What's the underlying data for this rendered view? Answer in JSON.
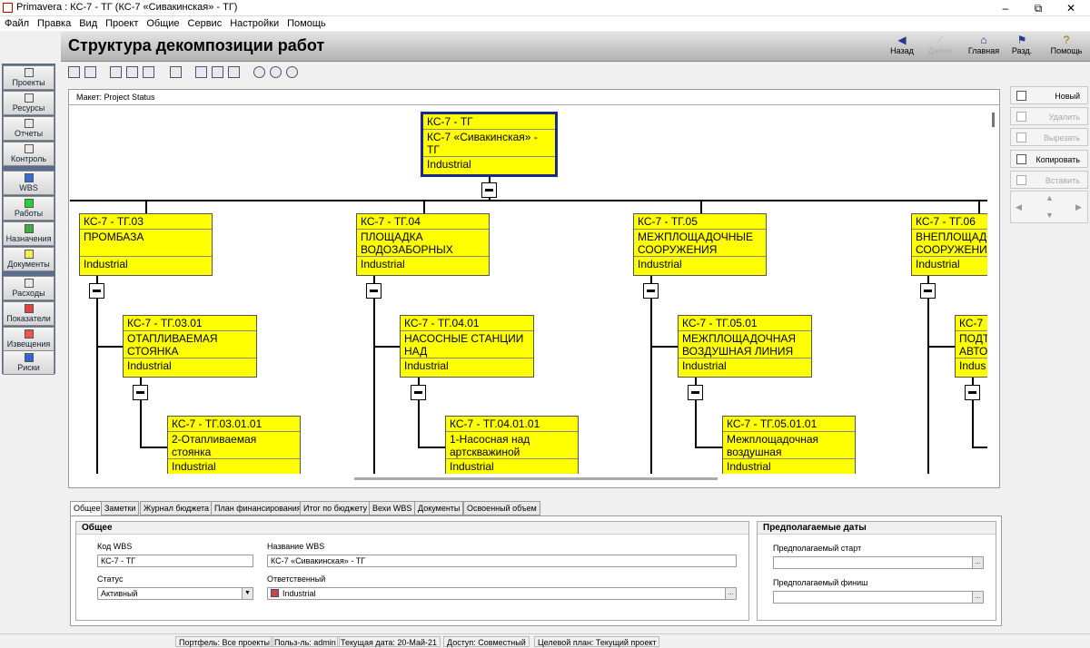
{
  "window": {
    "title": "Primavera : КС-7 - ТГ (КС-7 «Сивакинская» - ТГ)",
    "min": "–",
    "max": "⧉",
    "close": "✕"
  },
  "menu": [
    "Файл",
    "Правка",
    "Вид",
    "Проект",
    "Общие",
    "Сервис",
    "Настройки",
    "Помощь"
  ],
  "nav": [
    {
      "label": "Проекты",
      "icon": "projects-icon"
    },
    {
      "label": "Ресурсы",
      "icon": "resources-icon"
    },
    {
      "label": "Отчеты",
      "icon": "reports-icon"
    },
    {
      "label": "Контроль",
      "icon": "tracking-icon"
    },
    {
      "label": "WBS",
      "icon": "wbs-icon"
    },
    {
      "label": "Работы",
      "icon": "activities-icon"
    },
    {
      "label": "Назначения",
      "icon": "assignments-icon"
    },
    {
      "label": "Документы",
      "icon": "documents-icon"
    },
    {
      "label": "Расходы",
      "icon": "expenses-icon"
    },
    {
      "label": "Показатели",
      "icon": "indicators-icon"
    },
    {
      "label": "Извещения",
      "icon": "notices-icon"
    },
    {
      "label": "Риски",
      "icon": "risks-icon"
    }
  ],
  "header": {
    "title": "Структура декомпозиции работ",
    "back": "Назад",
    "forward": "Далее",
    "home": "Главная",
    "sections": "Разд.",
    "help": "Помощь"
  },
  "layout_label": "Макет: Project Status",
  "nodes": {
    "root": {
      "code": "КС-7 - ТГ",
      "name": "КС-7 «Сивакинская» - ТГ",
      "resp": "Industrial"
    },
    "n03": {
      "code": "КС-7 - ТГ.03",
      "name": "ПРОМБАЗА",
      "resp": "Industrial"
    },
    "n04": {
      "code": "КС-7 - ТГ.04",
      "name": "ПЛОЩАДКА ВОДОЗАБОРНЫХ",
      "resp": "Industrial"
    },
    "n05": {
      "code": "КС-7 - ТГ.05",
      "name": "МЕЖПЛОЩАДОЧНЫЕ СООРУЖЕНИЯ",
      "resp": "Industrial"
    },
    "n06": {
      "code": "КС-7 - ТГ.06",
      "name": "ВНЕПЛОЩАДОЧНЫЕ СООРУЖЕНИЯ",
      "resp": "Industrial"
    },
    "n0301": {
      "code": "КС-7 - ТГ.03.01",
      "name": "ОТАПЛИВАЕМАЯ СТОЯНКА",
      "resp": "Industrial"
    },
    "n0401": {
      "code": "КС-7 - ТГ.04.01",
      "name": "НАСОСНЫЕ СТАНЦИИ НАД",
      "resp": "Industrial"
    },
    "n0501": {
      "code": "КС-7 - ТГ.05.01",
      "name": "МЕЖПЛОЩАДОЧНАЯ ВОЗДУШНАЯ ЛИНИЯ",
      "resp": "Industrial"
    },
    "n0601": {
      "code": "КС-7",
      "name": "ПОДТ АВТО",
      "resp": "Indus"
    },
    "n030101": {
      "code": "КС-7 - ТГ.03.01.01",
      "name": "2-Отапливаемая стоянка",
      "resp": "Industrial"
    },
    "n040101": {
      "code": "КС-7 - ТГ.04.01.01",
      "name": "1-Насосная над артскважиной",
      "resp": "Industrial"
    },
    "n050101": {
      "code": "КС-7 - ТГ.05.01.01",
      "name": "Межплощадочная воздушная",
      "resp": "Industrial"
    }
  },
  "right": {
    "new": "Новый",
    "delete": "Удалить",
    "cut": "Вырезать",
    "copy": "Копировать",
    "paste": "Вставить"
  },
  "tabs": [
    "Общее",
    "Заметки",
    "Журнал бюджета",
    "План финансирования",
    "Итог по бюджету",
    "Вехи WBS",
    "Документы",
    "Освоенный объем"
  ],
  "general": {
    "group": "Общее",
    "code_label": "Код WBS",
    "code": "КС-7 - ТГ",
    "name_label": "Название WBS",
    "name": "КС-7 «Сивакинская» - ТГ",
    "status_label": "Статус",
    "status": "Активный",
    "resp_label": "Ответственный",
    "resp": "Industrial"
  },
  "dates": {
    "group": "Предполагаемые даты",
    "start_label": "Предполагаемый старт",
    "start": "",
    "finish_label": "Предполагаемый финиш",
    "finish": ""
  },
  "status": [
    "Портфель: Все проекты",
    "Польз-ль: admin",
    "Текущая дата: 20-Май-21",
    "Доступ: Совместный",
    "Целевой план: Текущий проект"
  ]
}
